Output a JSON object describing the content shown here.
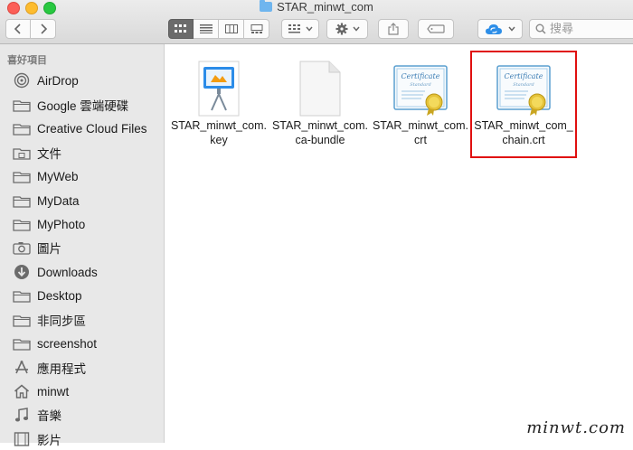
{
  "window": {
    "title": "STAR_minwt_com"
  },
  "toolbar": {
    "search_placeholder": "搜尋"
  },
  "sidebar": {
    "heading": "喜好項目",
    "items": [
      {
        "label": "AirDrop",
        "icon": "airdrop-icon"
      },
      {
        "label": "Google 雲端硬碟",
        "icon": "folder-icon"
      },
      {
        "label": "Creative Cloud Files",
        "icon": "folder-icon"
      },
      {
        "label": "文件",
        "icon": "document-icon"
      },
      {
        "label": "MyWeb",
        "icon": "folder-icon"
      },
      {
        "label": "MyData",
        "icon": "folder-icon"
      },
      {
        "label": "MyPhoto",
        "icon": "folder-icon"
      },
      {
        "label": "圖片",
        "icon": "camera-icon"
      },
      {
        "label": "Downloads",
        "icon": "download-icon"
      },
      {
        "label": "Desktop",
        "icon": "folder-icon"
      },
      {
        "label": "非同步區",
        "icon": "folder-icon"
      },
      {
        "label": "screenshot",
        "icon": "folder-icon"
      },
      {
        "label": "應用程式",
        "icon": "applications-icon"
      },
      {
        "label": "minwt",
        "icon": "home-icon"
      },
      {
        "label": "音樂",
        "icon": "music-icon"
      },
      {
        "label": "影片",
        "icon": "film-icon"
      }
    ]
  },
  "files": [
    {
      "name": "STAR_minwt_com.key",
      "icon": "keynote-icon"
    },
    {
      "name": "STAR_minwt_com.ca-bundle",
      "icon": "blank-document-icon"
    },
    {
      "name": "STAR_minwt_com.crt",
      "icon": "certificate-icon"
    },
    {
      "name": "STAR_minwt_com_chain.crt",
      "icon": "certificate-icon",
      "highlighted": true
    }
  ],
  "certificate_icon_text": {
    "line1": "Certificate",
    "line2": "Standard"
  },
  "watermark": "minwt.com",
  "colors": {
    "highlight": "#e01010",
    "sidebar_bg": "#e8e8e8",
    "folder_icon": "#6fb5ee"
  }
}
